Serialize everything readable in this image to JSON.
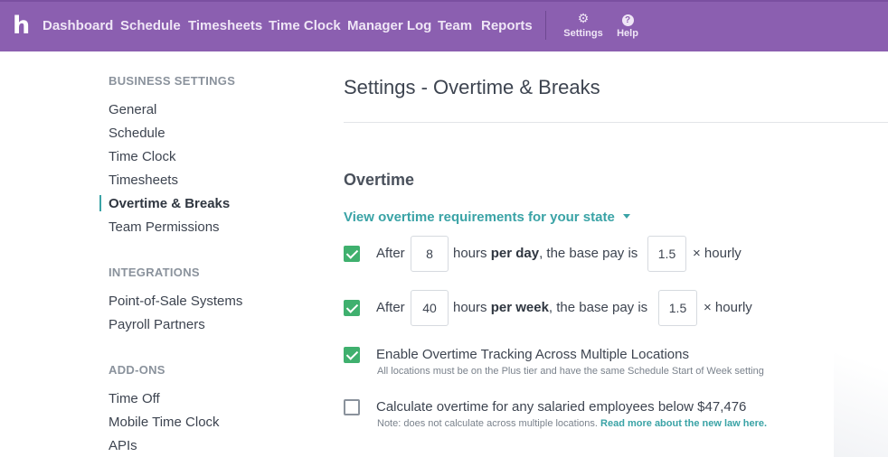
{
  "nav": {
    "logo": "h",
    "items": [
      "Dashboard",
      "Schedule",
      "Timesheets",
      "Time Clock",
      "Manager Log",
      "Team",
      "Reports"
    ],
    "settings_label": "Settings",
    "help_label": "Help",
    "settings_icon": "gear-icon",
    "help_icon": "question-circle-icon"
  },
  "sidebar": {
    "business_heading": "BUSINESS SETTINGS",
    "business_items": [
      "General",
      "Schedule",
      "Time Clock",
      "Timesheets",
      "Overtime & Breaks",
      "Team Permissions"
    ],
    "active_item": "Overtime & Breaks",
    "integrations_heading": "INTEGRATIONS",
    "integrations_items": [
      "Point-of-Sale Systems",
      "Payroll Partners"
    ],
    "addons_heading": "ADD-ONS",
    "addons_items": [
      "Time Off",
      "Mobile Time Clock",
      "APIs"
    ]
  },
  "main": {
    "title": "Settings - Overtime & Breaks",
    "section_title": "Overtime",
    "state_link": "View overtime requirements for your state",
    "daily": {
      "checked": true,
      "after": "After",
      "hours": "8",
      "mid_pre": "hours ",
      "mid_bold": "per day",
      "mid_post": ", the base pay is",
      "multiplier": "1.5",
      "suffix": "× hourly"
    },
    "weekly": {
      "checked": true,
      "after": "After",
      "hours": "40",
      "mid_pre": "hours ",
      "mid_bold": "per week",
      "mid_post": ", the base pay is",
      "multiplier": "1.5",
      "suffix": "× hourly"
    },
    "multi_location": {
      "checked": true,
      "label": "Enable Overtime Tracking Across Multiple Locations",
      "note": "All locations must be on the Plus tier and have the same Schedule Start of Week setting"
    },
    "salaried": {
      "checked": false,
      "label": "Calculate overtime for any salaried employees below $47,476",
      "note": "Note: does not calculate across multiple locations.",
      "note_link": "Read more about the new law here."
    }
  },
  "colors": {
    "nav_bg": "#8b5fb0",
    "accent_teal": "#3aa3a6",
    "checkbox_green": "#3fb06e"
  }
}
